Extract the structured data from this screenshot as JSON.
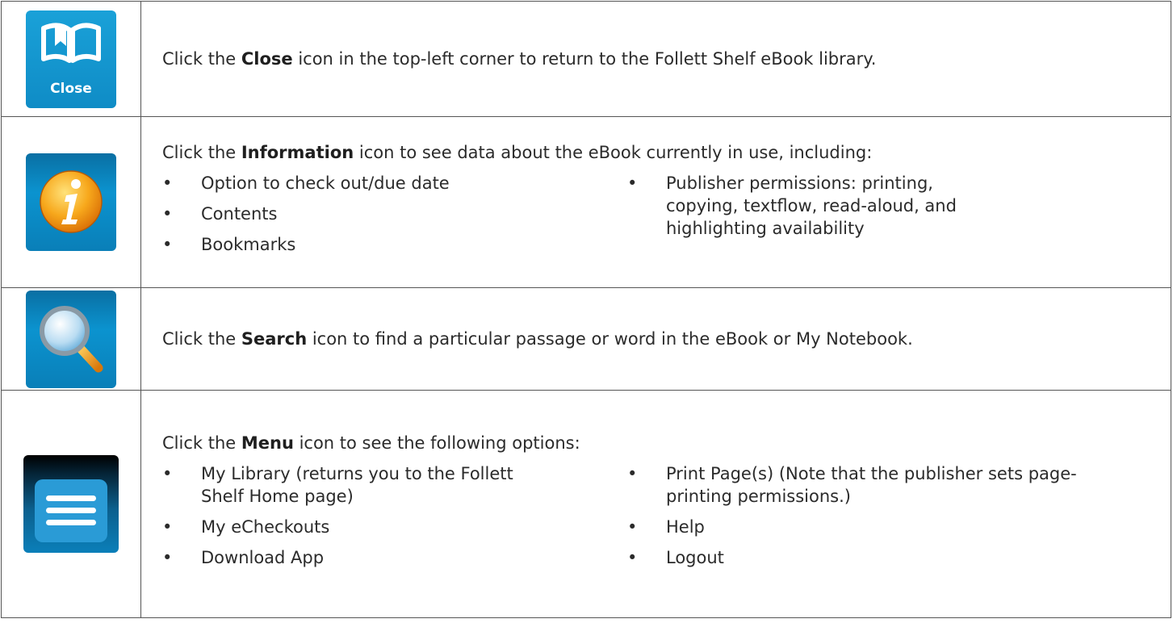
{
  "rows": [
    {
      "icon": "close-book-icon",
      "icon_label": "Close",
      "pre": "Click the ",
      "term": "Close",
      "post": " icon in the top-left corner to return to the Follett Shelf eBook library."
    },
    {
      "icon": "information-icon",
      "pre": "Click the ",
      "term": "Information",
      "post": " icon to see data about the eBook currently in use, including:",
      "col1": [
        "Option to check out/due date",
        "Contents",
        "Bookmarks"
      ],
      "col2": [
        "Publisher permissions: printing, copying, textflow, read-aloud, and highlighting availability"
      ]
    },
    {
      "icon": "magnifier-icon",
      "pre": "Click the ",
      "term": "Search",
      "post": " icon to find a particular passage or word in the eBook or My Notebook."
    },
    {
      "icon": "hamburger-menu-icon",
      "pre": "Click the ",
      "term": "Menu",
      "post": " icon to see the following options:",
      "col1": [
        "My Library (returns you to the Follett Shelf Home page)",
        "My eCheckouts",
        "Download App"
      ],
      "col2": [
        "Print Page(s) (Note that the publisher sets page-printing permissions.)",
        "Help",
        "Logout"
      ]
    }
  ]
}
